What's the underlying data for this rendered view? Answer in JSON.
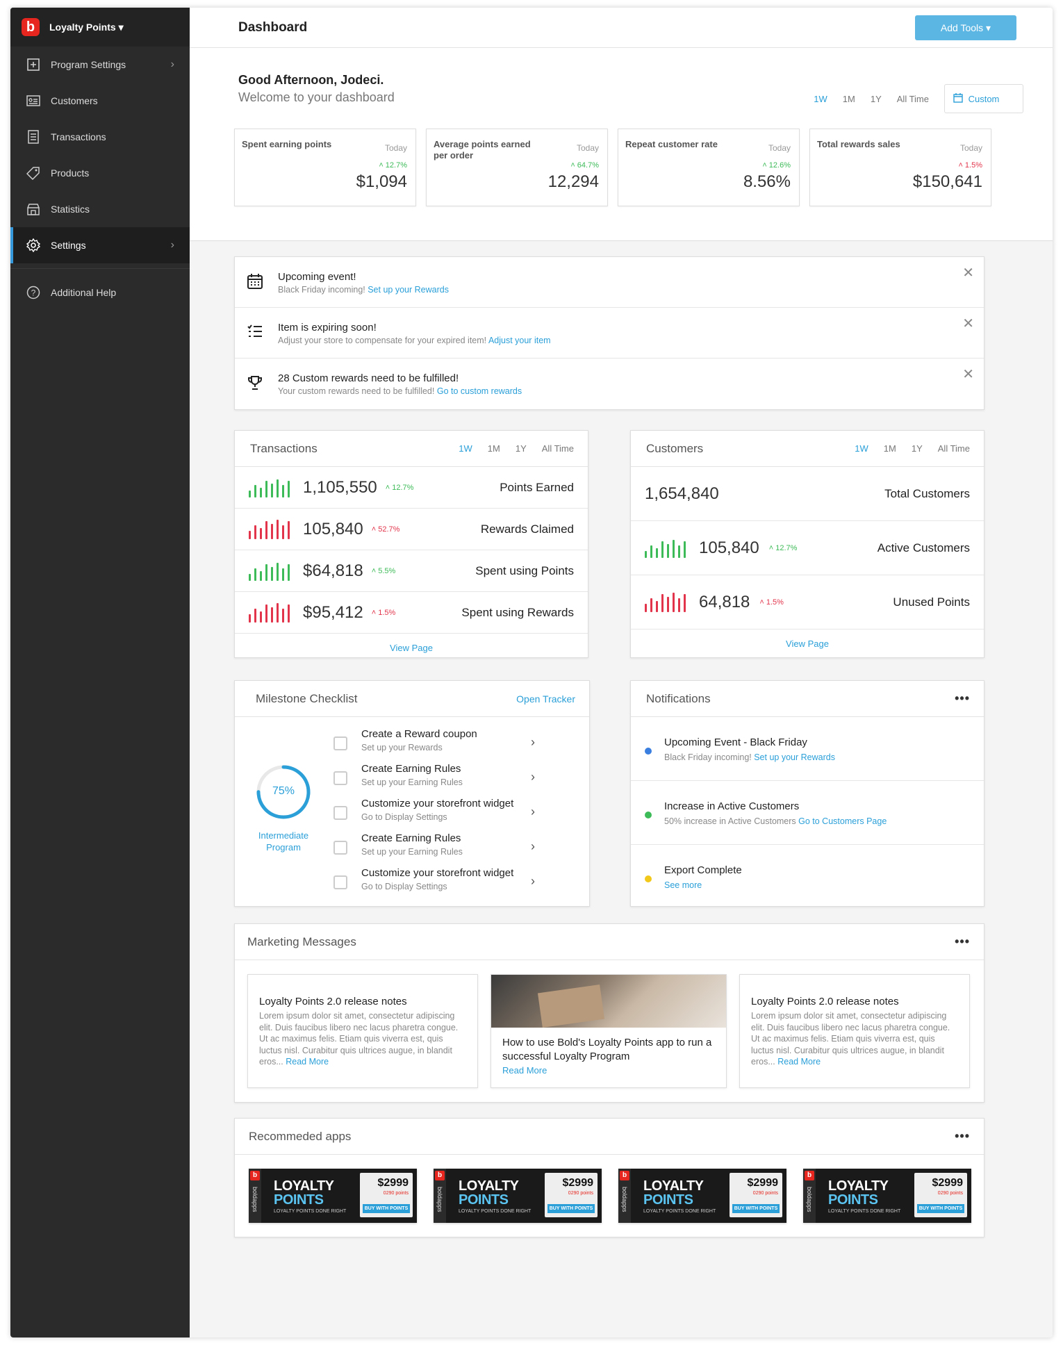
{
  "sidebar": {
    "brand": "Loyalty Points ▾",
    "items": [
      {
        "label": "Program Settings",
        "icon": "plus-square-icon"
      },
      {
        "label": "Customers",
        "icon": "id-card-icon"
      },
      {
        "label": "Transactions",
        "icon": "receipt-icon"
      },
      {
        "label": "Products",
        "icon": "tag-icon"
      },
      {
        "label": "Statistics",
        "icon": "store-icon"
      },
      {
        "label": "Settings",
        "icon": "gear-icon"
      },
      {
        "label": "Additional Help",
        "icon": "help-icon"
      }
    ]
  },
  "header": {
    "title": "Dashboard",
    "add_tools": "Add Tools ▾"
  },
  "greeting": {
    "title": "Good Afternoon, Jodeci.",
    "subtitle": "Welcome to your dashboard"
  },
  "ranges": [
    "1W",
    "1M",
    "1Y",
    "All Time"
  ],
  "custom_label": "Custom",
  "stats": [
    {
      "label": "Spent earning points",
      "period": "Today",
      "change": "˄ 12.7%",
      "value": "$1,094",
      "color": "#3dbb58"
    },
    {
      "label": "Average points earned per order",
      "period": "Today",
      "change": "˄ 64.7%",
      "value": "12,294",
      "color": "#3dbb58"
    },
    {
      "label": "Repeat customer rate",
      "period": "Today",
      "change": "˄ 12.6%",
      "value": "8.56%",
      "color": "#3dbb58"
    },
    {
      "label": "Total rewards sales",
      "period": "Today",
      "change": "˄ 1.5%",
      "value": "$150,641",
      "color": "#e2354c"
    }
  ],
  "alerts": [
    {
      "title": "Upcoming event!",
      "desc": "Black Friday incoming! ",
      "link": "Set up your Rewards",
      "icon": "calendar-icon"
    },
    {
      "title": "Item is expiring soon!",
      "desc": "Adjust your store to compensate for your expired item! ",
      "link": "Adjust your item",
      "icon": "list-icon"
    },
    {
      "title": "28 Custom rewards need to be fulfilled!",
      "desc": "Your custom rewards need to be fulfilled! ",
      "link": "Go to custom rewards",
      "icon": "trophy-icon"
    }
  ],
  "transactions": {
    "title": "Transactions",
    "rows": [
      {
        "value": "1,105,550",
        "change": "˄ 12.7%",
        "label": "Points Earned",
        "trend": "up"
      },
      {
        "value": "105,840",
        "change": "˄ 52.7%",
        "label": "Rewards Claimed",
        "trend": "down"
      },
      {
        "value": "$64,818",
        "change": "˄ 5.5%",
        "label": "Spent using Points",
        "trend": "up"
      },
      {
        "value": "$95,412",
        "change": "˄ 1.5%",
        "label": "Spent using Rewards",
        "trend": "down"
      }
    ],
    "view_page": "View Page"
  },
  "customers": {
    "title": "Customers",
    "total": {
      "value": "1,654,840",
      "label": "Total Customers"
    },
    "rows": [
      {
        "value": "105,840",
        "change": "˄ 12.7%",
        "label": "Active Customers",
        "trend": "up"
      },
      {
        "value": "64,818",
        "change": "˄ 1.5%",
        "label": "Unused Points",
        "trend": "down"
      }
    ],
    "view_page": "View Page"
  },
  "milestone": {
    "title": "Milestone Checklist",
    "open_tracker": "Open Tracker",
    "progress": 0.75,
    "progress_label": "75%",
    "program": "Intermediate Program",
    "items": [
      {
        "title": "Create a Reward coupon",
        "desc": "Set up your Rewards"
      },
      {
        "title": "Create Earning Rules",
        "desc": "Set up your Earning Rules"
      },
      {
        "title": "Customize your storefront widget",
        "desc": "Go to Display Settings"
      },
      {
        "title": "Create Earning Rules",
        "desc": "Set up your Earning Rules"
      },
      {
        "title": "Customize your storefront widget",
        "desc": "Go to Display Settings"
      }
    ]
  },
  "notifications": {
    "title": "Notifications",
    "items": [
      {
        "title": "Upcoming Event - Black Friday",
        "desc": "Black Friday incoming! ",
        "link": "Set up your Rewards",
        "color": "#3a7fe0"
      },
      {
        "title": "Increase in Active Customers",
        "desc": "50% increase in Active Customers ",
        "link": "Go to Customers Page",
        "color": "#3dbb58"
      },
      {
        "title": "Export Complete",
        "desc": "",
        "link": "See more",
        "color": "#f2c81a"
      }
    ]
  },
  "marketing": {
    "title": "Marketing Messages",
    "cards": [
      {
        "title": "Loyalty Points 2.0 release notes",
        "body": "Lorem ipsum dolor sit amet, consectetur adipiscing elit. Duis faucibus libero nec lacus pharetra congue. Ut ac maximus felis. Etiam quis viverra est, quis luctus nisl. Curabitur quis ultrices augue, in blandit eros... ",
        "link": "Read More"
      },
      {
        "title": "How to use Bold's Loyalty Points app to run a successful Loyalty Program",
        "link": "Read More"
      },
      {
        "title": "Loyalty Points 2.0 release notes",
        "body": "Lorem ipsum dolor sit amet, consectetur adipiscing elit. Duis faucibus libero nec lacus pharetra congue. Ut ac maximus felis. Etiam quis viverra est, quis luctus nisl. Curabitur quis ultrices augue, in blandit eros... ",
        "link": "Read More"
      }
    ]
  },
  "recommended": {
    "title": "Recommeded apps",
    "banner": {
      "line1": "LOYALTY",
      "line2": "POINTS",
      "tagline": "LOYALTY POINTS DONE RIGHT",
      "price": "$2999",
      "points": "0290 points",
      "button": "BUY WITH POINTS",
      "vendor": "boldapps"
    }
  }
}
